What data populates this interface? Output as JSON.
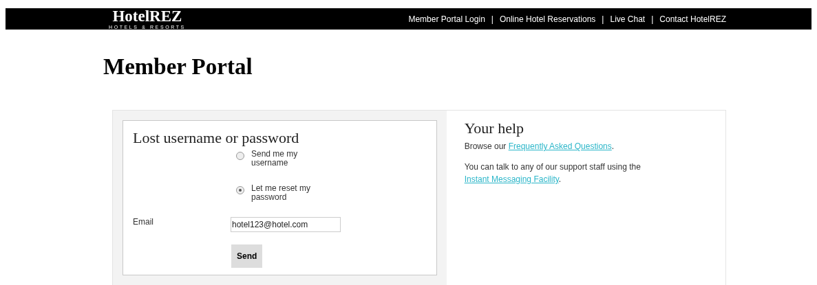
{
  "header": {
    "logo": {
      "name": "HotelREZ",
      "tagline": "HOTELS & RESORTS"
    },
    "nav": [
      "Member Portal Login",
      "Online Hotel Reservations",
      "Live Chat",
      "Contact HotelREZ"
    ],
    "separator": "|"
  },
  "page_title": "Member Portal",
  "form": {
    "title": "Lost username or password",
    "options": [
      {
        "label": "Send me my username",
        "selected": false
      },
      {
        "label": "Let me reset my password",
        "selected": true
      }
    ],
    "email": {
      "label": "Email",
      "value": "hotel123@hotel.com"
    },
    "submit": "Send"
  },
  "help": {
    "title": "Your help",
    "paragraphs": [
      {
        "before": "Browse our ",
        "link": "Frequently Asked Questions",
        "after": "."
      },
      {
        "before": "You can talk to any of our support staff using the ",
        "link": "Instant Messaging Facility",
        "after": "."
      }
    ]
  }
}
